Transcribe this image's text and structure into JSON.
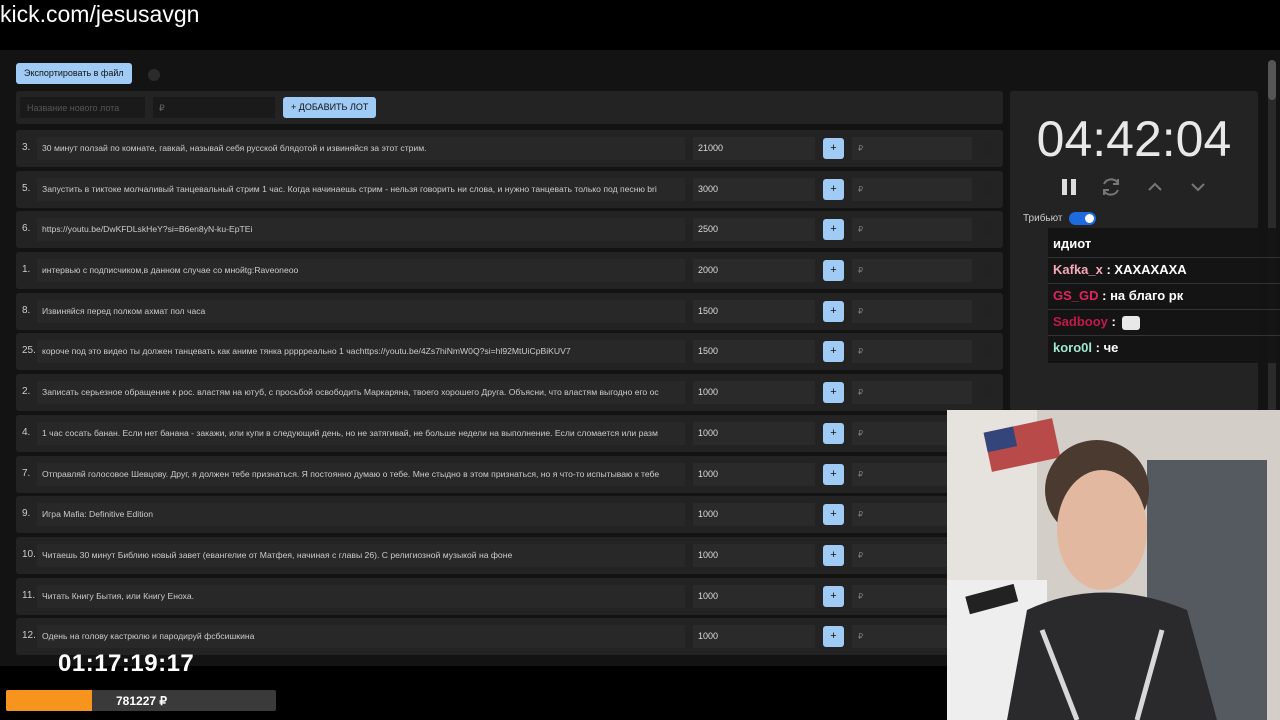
{
  "url": "kick.com/jesusavgn",
  "toolbar": {
    "export_label": "Экспортировать в файл"
  },
  "add_lot": {
    "name_placeholder": "Название нового лота",
    "price_placeholder": "₽",
    "add_label": "+ ДОБАВИТЬ ЛОТ"
  },
  "lots": [
    {
      "num": "3.",
      "title": "30 минут ползай по комнате, гавкай, называй себя русской блядотой и извиняйся за этот стрим.",
      "amount": "21000",
      "plus": "+",
      "rub": "₽"
    },
    {
      "num": "5.",
      "title": "Запустить в тиктоке молчаливый танцевальный стрим 1 час. Когда начинаешь стрим - нельзя говорить ни слова, и нужно танцевать только под песню bri",
      "amount": "3000",
      "plus": "+",
      "rub": "₽"
    },
    {
      "num": "6.",
      "title": "https://youtu.be/DwKFDLskHeY?si=B6en8yN-ku-EpTEi",
      "amount": "2500",
      "plus": "+",
      "rub": "₽"
    },
    {
      "num": "1.",
      "title": "интервью с подписчиком,в данном случае со мнойtg:Raveoneoo",
      "amount": "2000",
      "plus": "+",
      "rub": "₽"
    },
    {
      "num": "8.",
      "title": "Извиняйся перед полком ахмат пол часа",
      "amount": "1500",
      "plus": "+",
      "rub": "₽"
    },
    {
      "num": "25.",
      "title": "короче под это видео ты должен танцевать как аниме тянка ррррреально 1 часhttps://youtu.be/4Zs7hiNmW0Q?si=hl92MtUiCpBiKUV7",
      "amount": "1500",
      "plus": "+",
      "rub": "₽"
    },
    {
      "num": "2.",
      "title": "Записать серьезное обращение к рос. властям на ютуб, с просьбой освободить Маркаряна, твоего хорошего Друга. Объясни, что властям выгодно его ос",
      "amount": "1000",
      "plus": "+",
      "rub": "₽"
    },
    {
      "num": "4.",
      "title": "1 час сосать банан. Если нет банана - закажи, или купи в следующий день, но не затягивай, не больше недели на выполнение. Если сломается или разм",
      "amount": "1000",
      "plus": "+",
      "rub": "₽"
    },
    {
      "num": "7.",
      "title": "Отправляй голосовое Шевцову. Друг, я должен тебе признаться. Я постоянно думаю о тебе. Мне стыдно в этом признаться, но я что-то испытываю к тебе",
      "amount": "1000",
      "plus": "+",
      "rub": "₽"
    },
    {
      "num": "9.",
      "title": "Игра Mafia: Definitive Edition",
      "amount": "1000",
      "plus": "+",
      "rub": "₽"
    },
    {
      "num": "10.",
      "title": "Читаешь 30 минут Библию новый завет (евангелие от Матфея, начиная с главы 26). С религиозной музыкой на фоне",
      "amount": "1000",
      "plus": "+",
      "rub": "₽"
    },
    {
      "num": "11.",
      "title": "Читать Книгу Бытия, или Книгу Еноха.",
      "amount": "1000",
      "plus": "+",
      "rub": "₽"
    },
    {
      "num": "12.",
      "title": "Одень на голову кастрюлю и пародируй фсбсишкина",
      "amount": "1000",
      "plus": "+",
      "rub": "₽"
    }
  ],
  "timer": {
    "value": "04:42:04"
  },
  "tribute": {
    "label": "Трибьют",
    "enabled": true
  },
  "chat": {
    "messages": [
      {
        "user": "",
        "text": "идиот",
        "color": "#ffffff"
      },
      {
        "user": "Kafka_x",
        "text": " : ХАХАХАХА",
        "color": "#f4a9b8"
      },
      {
        "user": "GS_GD",
        "text": " : на благо рк",
        "color": "#e0245e"
      },
      {
        "user": "Sadbooy",
        "text": " : ",
        "color": "#c21a4a"
      },
      {
        "user": "koro0l",
        "text": " : че",
        "color": "#9fe8d0"
      }
    ]
  },
  "stream": {
    "elapsed": "01:17:19:17",
    "total": "781227 ₽",
    "progress": 0.32
  },
  "colors": {
    "accent": "#9fcbf5",
    "progress": "#f7941d",
    "toggle": "#1e6be0"
  }
}
